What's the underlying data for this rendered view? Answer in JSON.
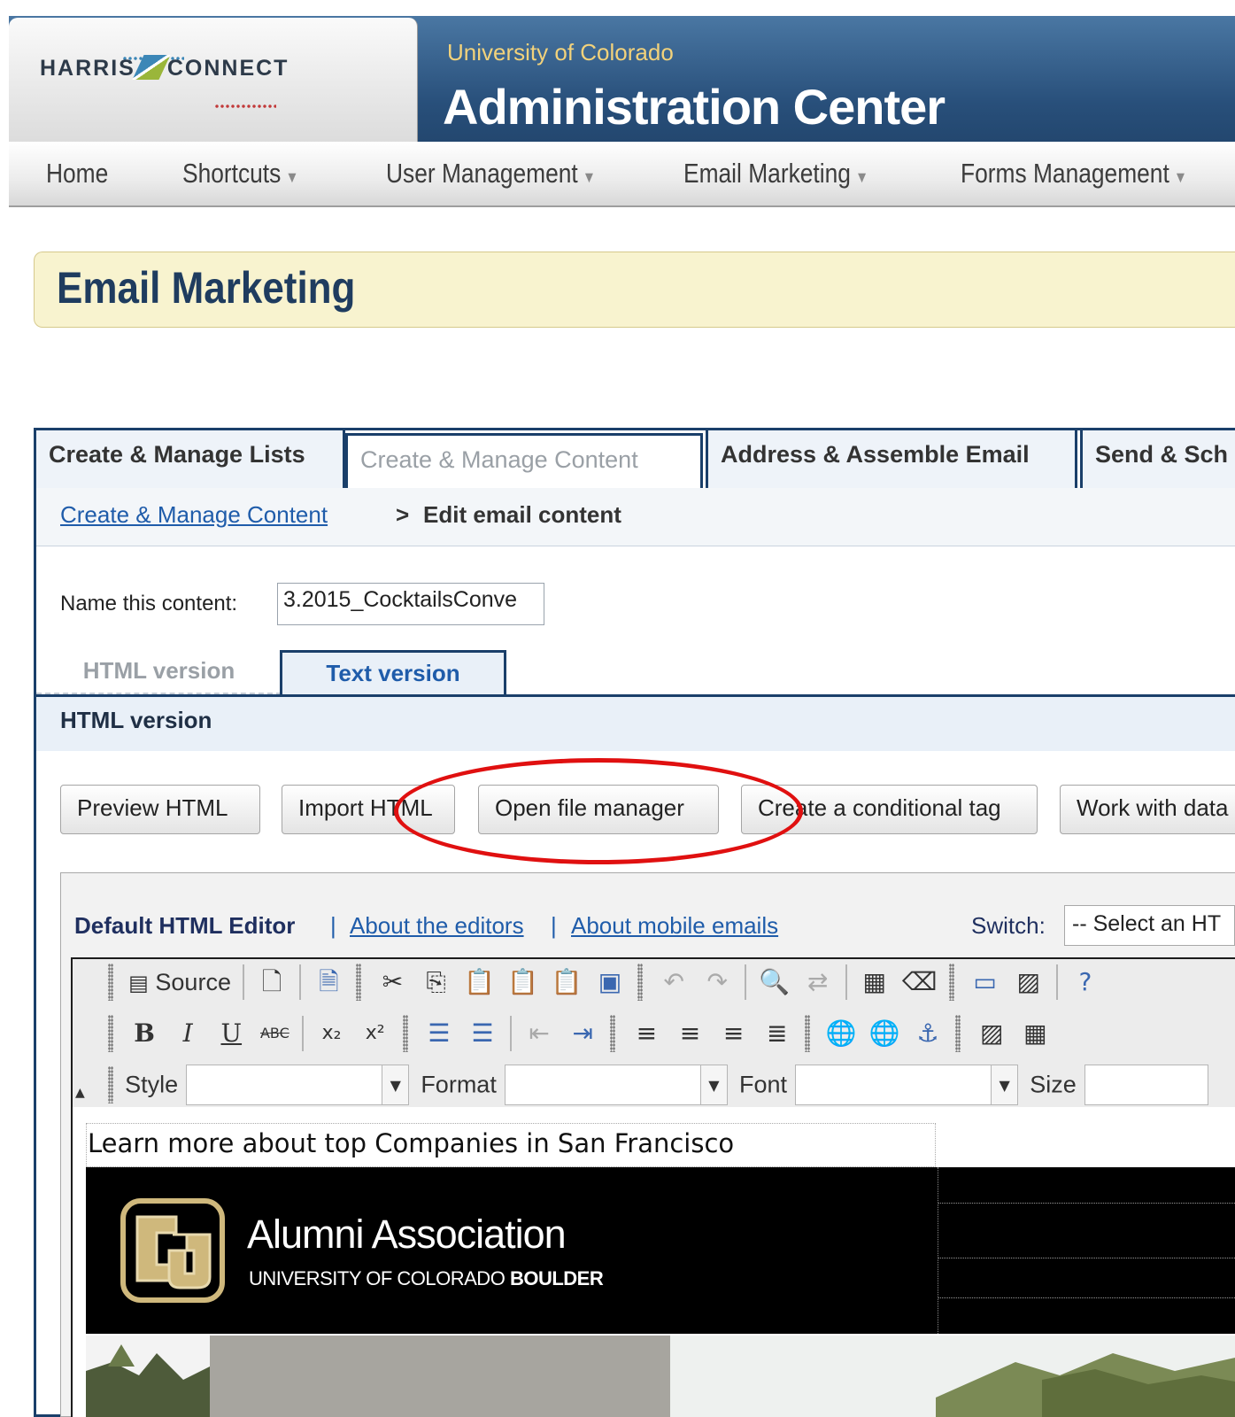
{
  "header": {
    "logo_text_left": "HARRIS",
    "logo_text_right": "CONNECT",
    "university": "University of Colorado",
    "title": "Administration Center"
  },
  "nav": {
    "items": [
      {
        "label": "Home",
        "has_menu": false
      },
      {
        "label": "Shortcuts",
        "has_menu": true
      },
      {
        "label": "User Management",
        "has_menu": true
      },
      {
        "label": "Email Marketing",
        "has_menu": true
      },
      {
        "label": "Forms Management",
        "has_menu": true
      }
    ],
    "caret": "▼"
  },
  "page_title": "Email Marketing",
  "tabs": [
    {
      "label": "Create & Manage Lists",
      "active": false
    },
    {
      "label": "Create & Manage Content",
      "active": true
    },
    {
      "label": "Address & Assemble Email",
      "active": false
    },
    {
      "label": "Send & Sch",
      "active": false
    }
  ],
  "breadcrumb": {
    "parent": "Create & Manage Content",
    "separator": ">",
    "current": "Edit email content"
  },
  "content_name": {
    "label": "Name this content:",
    "value": "3.2015_CocktailsConve"
  },
  "version_tabs": {
    "html": "HTML version",
    "text": "Text version",
    "active": "HTML version"
  },
  "section_label": "HTML version",
  "buttons": {
    "preview": "Preview HTML",
    "import": "Import HTML",
    "file_manager": "Open file manager",
    "conditional": "Create a conditional tag",
    "data": "Work with data"
  },
  "annotation": {
    "highlighted": "Open file manager",
    "color": "#e01010"
  },
  "editor": {
    "title": "Default HTML Editor",
    "separator": "|",
    "link_about_editors": "About the editors",
    "link_mobile": "About mobile emails",
    "switch_label": "Switch:",
    "switch_value": "-- Select an HT"
  },
  "toolbar": {
    "source_label": "Source",
    "bold": "B",
    "italic": "I",
    "underline": "U",
    "strike": "ABC",
    "style_label": "Style",
    "format_label": "Format",
    "font_label": "Font",
    "size_label": "Size",
    "row1_icons": [
      "source-icon",
      "new-page-icon",
      "templates-icon",
      "cut-icon",
      "copy-icon",
      "paste-icon",
      "paste-text-icon",
      "paste-word-icon",
      "undo-icon",
      "redo-icon",
      "find-icon",
      "replace-icon",
      "select-all-icon",
      "remove-format-icon",
      "form-icon",
      "image-icon",
      "help-icon"
    ],
    "row2_icons": [
      "bold-icon",
      "italic-icon",
      "underline-icon",
      "strike-icon",
      "subscript-icon",
      "superscript-icon",
      "numbered-list-icon",
      "bulleted-list-icon",
      "outdent-icon",
      "indent-icon",
      "align-left-icon",
      "align-center-icon",
      "align-right-icon",
      "justify-icon",
      "link-icon",
      "unlink-icon",
      "anchor-icon",
      "image-icon",
      "table-icon"
    ]
  },
  "email_content": {
    "intro": "Learn more about top Companies in San Francisco",
    "banner_title": "Alumni Association",
    "banner_sub_normal": "UNIVERSITY OF COLORADO",
    "banner_sub_bold": "BOULDER"
  },
  "colors": {
    "header_blue": "#284f7a",
    "tab_border": "#1a3f6a",
    "link": "#1f5caa",
    "heading": "#1f3c5f",
    "cu_gold": "#cfb87c"
  }
}
